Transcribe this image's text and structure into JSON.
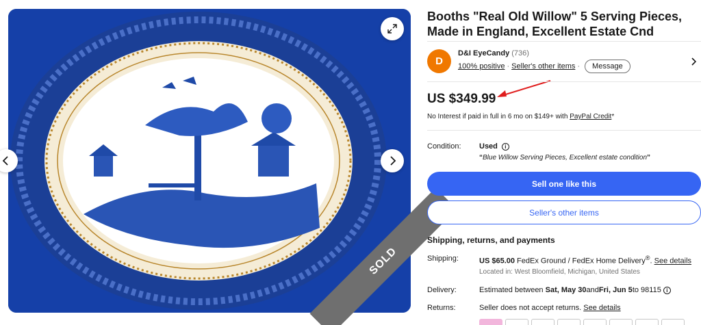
{
  "gallery": {
    "badge": "SOLD",
    "colors": {
      "plate_blue": "#1f4aa8",
      "background_blue": "#1540a8",
      "rim_cream": "#f5ecd6"
    }
  },
  "listing": {
    "title": "Booths \"Real Old Willow\" 5 Serving Pieces, Made in England, Excellent Estate Cnd"
  },
  "seller": {
    "avatar_letter": "D",
    "name": "D&I EyeCandy",
    "feedback_count": "(736)",
    "positive": "100% positive",
    "other_items_link": "Seller's other items",
    "message_button": "Message"
  },
  "price": {
    "amount": "US $349.99",
    "credit_prefix": "No Interest if paid in full in 6 mo on $149+ with ",
    "credit_link": "PayPal Credit",
    "credit_suffix": "*"
  },
  "condition": {
    "label": "Condition:",
    "value": "Used",
    "quote_open": "“",
    "quote_text": "Blue Willow Serving Pieces, Excellent estate condition",
    "quote_close": "”"
  },
  "buttons": {
    "sell_one_like_this": "Sell one like this",
    "sellers_other_items": "Seller's other items"
  },
  "shipping": {
    "heading": "Shipping, returns, and payments",
    "shipping_label": "Shipping:",
    "shipping_price": "US $65.00",
    "shipping_method": " FedEx Ground / FedEx Home Delivery",
    "shipping_reg": "®",
    "shipping_period": ". ",
    "shipping_details": "See details",
    "location": "Located in: West Bloomfield, Michigan, United States",
    "delivery_label": "Delivery:",
    "delivery_prefix": "Estimated between ",
    "delivery_start": "Sat, May 30",
    "delivery_and": " and ",
    "delivery_end": "Fri, Jun 5",
    "delivery_suffix": " to 98115",
    "returns_label": "Returns:",
    "returns_text": "Seller does not accept returns. ",
    "returns_details": "See details"
  },
  "colors": {
    "accent": "#3665f3",
    "avatar": "#f07800",
    "arrow": "#e01e1e",
    "sold_ribbon": "#6f6f6f"
  }
}
